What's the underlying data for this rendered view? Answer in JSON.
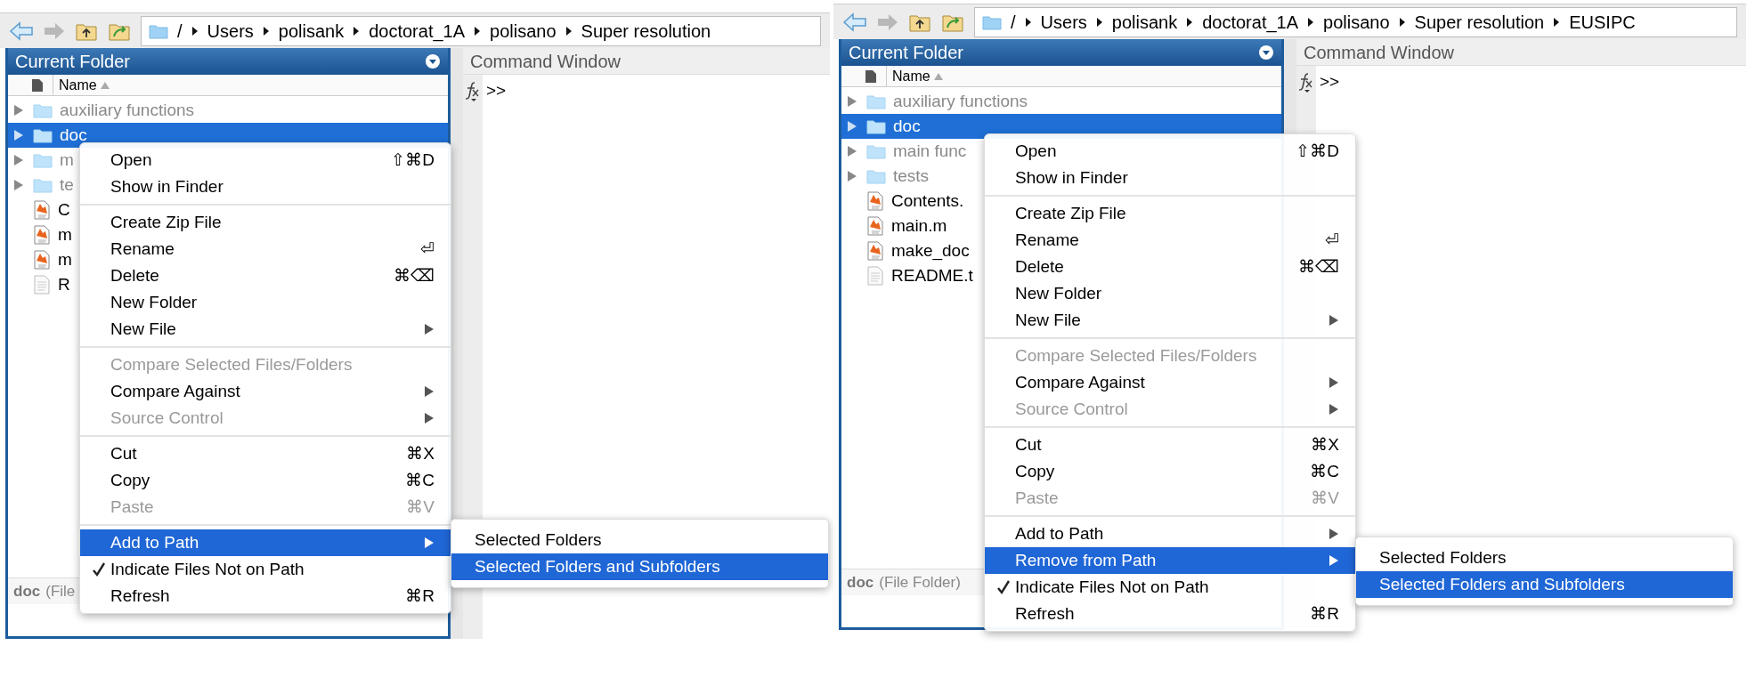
{
  "panels": [
    {
      "path": [
        "/",
        "Users",
        "polisank",
        "doctorat_1A",
        "polisano",
        "Super resolution"
      ],
      "folder_title": "Current Folder",
      "column_name": "Name",
      "command_title": "Command Window",
      "prompt": ">>",
      "files": [
        {
          "kind": "folder",
          "name": "auxiliary functions",
          "on_path": false,
          "selected": false
        },
        {
          "kind": "folder",
          "name": "doc",
          "selected": true
        },
        {
          "kind": "folder",
          "name": "m",
          "on_path": false,
          "selected": false
        },
        {
          "kind": "folder",
          "name": "te",
          "on_path": false,
          "selected": false
        },
        {
          "kind": "mfile",
          "name": "C",
          "on_path": true,
          "selected": false
        },
        {
          "kind": "mfile",
          "name": "m",
          "on_path": true,
          "selected": false
        },
        {
          "kind": "mfile",
          "name": "m",
          "on_path": true,
          "selected": false
        },
        {
          "kind": "text",
          "name": "R",
          "on_path": true,
          "selected": false
        }
      ],
      "status": {
        "name": "doc",
        "type": "(File"
      },
      "menu": [
        [
          {
            "label": "Open",
            "shortcut": "⇧⌘D",
            "submenu": false,
            "disabled": false,
            "checked": false,
            "selected": false
          },
          {
            "label": "Show in Finder",
            "submenu": false,
            "disabled": false,
            "checked": false,
            "selected": false
          }
        ],
        [
          {
            "label": "Create Zip File",
            "submenu": false,
            "disabled": false,
            "checked": false,
            "selected": false
          },
          {
            "label": "Rename",
            "shortcut": "⏎",
            "submenu": false,
            "disabled": false,
            "checked": false,
            "selected": false
          },
          {
            "label": "Delete",
            "shortcut": "⌘⌫",
            "submenu": false,
            "disabled": false,
            "checked": false,
            "selected": false
          },
          {
            "label": "New Folder",
            "submenu": false,
            "disabled": false,
            "checked": false,
            "selected": false
          },
          {
            "label": "New File",
            "submenu": true,
            "disabled": false,
            "checked": false,
            "selected": false
          }
        ],
        [
          {
            "label": "Compare Selected Files/Folders",
            "submenu": false,
            "disabled": true,
            "checked": false,
            "selected": false
          },
          {
            "label": "Compare Against",
            "submenu": true,
            "disabled": false,
            "checked": false,
            "selected": false
          },
          {
            "label": "Source Control",
            "submenu": true,
            "disabled": true,
            "checked": false,
            "selected": false
          }
        ],
        [
          {
            "label": "Cut",
            "shortcut": "⌘X",
            "submenu": false,
            "disabled": false,
            "checked": false,
            "selected": false
          },
          {
            "label": "Copy",
            "shortcut": "⌘C",
            "submenu": false,
            "disabled": false,
            "checked": false,
            "selected": false
          },
          {
            "label": "Paste",
            "shortcut": "⌘V",
            "submenu": false,
            "disabled": true,
            "checked": false,
            "selected": false
          }
        ],
        [
          {
            "label": "Add to Path",
            "submenu": true,
            "disabled": false,
            "checked": false,
            "selected": true
          },
          {
            "label": "Indicate Files Not on Path",
            "submenu": false,
            "disabled": false,
            "checked": true,
            "selected": false
          },
          {
            "label": "Refresh",
            "shortcut": "⌘R",
            "submenu": false,
            "disabled": false,
            "checked": false,
            "selected": false
          }
        ]
      ],
      "submenu": [
        {
          "label": "Selected Folders",
          "selected": false
        },
        {
          "label": "Selected Folders and Subfolders",
          "selected": true
        }
      ]
    },
    {
      "path": [
        "/",
        "Users",
        "polisank",
        "doctorat_1A",
        "polisano",
        "Super resolution",
        "EUSIPC"
      ],
      "folder_title": "Current Folder",
      "column_name": "Name",
      "command_title": "Command Window",
      "prompt": ">>",
      "files": [
        {
          "kind": "folder",
          "name": "auxiliary functions",
          "on_path": false,
          "selected": false
        },
        {
          "kind": "folder",
          "name": "doc",
          "selected": true
        },
        {
          "kind": "folder",
          "name": "main func",
          "on_path": false,
          "selected": false
        },
        {
          "kind": "folder",
          "name": "tests",
          "on_path": false,
          "selected": false
        },
        {
          "kind": "mfile",
          "name": "Contents.",
          "on_path": true,
          "selected": false
        },
        {
          "kind": "mfile",
          "name": "main.m",
          "on_path": true,
          "selected": false
        },
        {
          "kind": "mfile",
          "name": "make_doc",
          "on_path": true,
          "selected": false
        },
        {
          "kind": "text",
          "name": "README.t",
          "on_path": true,
          "selected": false
        }
      ],
      "status": {
        "name": "doc",
        "type": "(File Folder)"
      },
      "menu": [
        [
          {
            "label": "Open",
            "shortcut": "⇧⌘D",
            "submenu": false,
            "disabled": false,
            "checked": false,
            "selected": false
          },
          {
            "label": "Show in Finder",
            "submenu": false,
            "disabled": false,
            "checked": false,
            "selected": false
          }
        ],
        [
          {
            "label": "Create Zip File",
            "submenu": false,
            "disabled": false,
            "checked": false,
            "selected": false
          },
          {
            "label": "Rename",
            "shortcut": "⏎",
            "submenu": false,
            "disabled": false,
            "checked": false,
            "selected": false
          },
          {
            "label": "Delete",
            "shortcut": "⌘⌫",
            "submenu": false,
            "disabled": false,
            "checked": false,
            "selected": false
          },
          {
            "label": "New Folder",
            "submenu": false,
            "disabled": false,
            "checked": false,
            "selected": false
          },
          {
            "label": "New File",
            "submenu": true,
            "disabled": false,
            "checked": false,
            "selected": false
          }
        ],
        [
          {
            "label": "Compare Selected Files/Folders",
            "submenu": false,
            "disabled": true,
            "checked": false,
            "selected": false
          },
          {
            "label": "Compare Against",
            "submenu": true,
            "disabled": false,
            "checked": false,
            "selected": false
          },
          {
            "label": "Source Control",
            "submenu": true,
            "disabled": true,
            "checked": false,
            "selected": false
          }
        ],
        [
          {
            "label": "Cut",
            "shortcut": "⌘X",
            "submenu": false,
            "disabled": false,
            "checked": false,
            "selected": false
          },
          {
            "label": "Copy",
            "shortcut": "⌘C",
            "submenu": false,
            "disabled": false,
            "checked": false,
            "selected": false
          },
          {
            "label": "Paste",
            "shortcut": "⌘V",
            "submenu": false,
            "disabled": true,
            "checked": false,
            "selected": false
          }
        ],
        [
          {
            "label": "Add to Path",
            "submenu": true,
            "disabled": false,
            "checked": false,
            "selected": false
          },
          {
            "label": "Remove from Path",
            "submenu": true,
            "disabled": false,
            "checked": false,
            "selected": true
          },
          {
            "label": "Indicate Files Not on Path",
            "submenu": false,
            "disabled": false,
            "checked": true,
            "selected": false
          },
          {
            "label": "Refresh",
            "shortcut": "⌘R",
            "submenu": false,
            "disabled": false,
            "checked": false,
            "selected": false
          }
        ]
      ],
      "submenu": [
        {
          "label": "Selected Folders",
          "selected": false
        },
        {
          "label": "Selected Folders and Subfolders",
          "selected": true
        }
      ]
    }
  ]
}
